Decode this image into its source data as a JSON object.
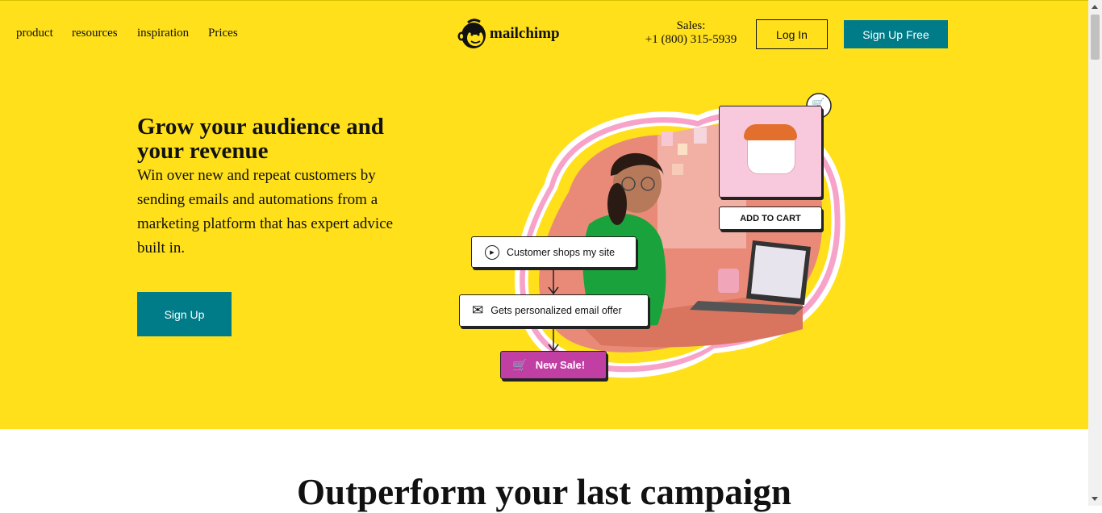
{
  "nav": {
    "links": [
      "product",
      "resources",
      "inspiration",
      "Prices"
    ],
    "logo_text": "mailchimp",
    "sales_label": "Sales:",
    "sales_phone": "+1 (800) 315-5939",
    "login_label": "Log In",
    "signup_free_label": "Sign Up Free"
  },
  "hero": {
    "headline": "Grow your audience and your revenue",
    "subtext": "Win over new and repeat customers by sending emails and automations from a marketing platform that has expert advice built in.",
    "cta_label": "Sign Up",
    "illustration": {
      "add_to_cart": "ADD TO CART",
      "step1": "Customer shops my site",
      "step2": "Gets personalized email offer",
      "step3": "New Sale!"
    }
  },
  "section2": {
    "title": "Outperform your last campaign"
  },
  "colors": {
    "brand_yellow": "#ffe01b",
    "teal": "#007c89",
    "sale_pink": "#c13ea3"
  }
}
